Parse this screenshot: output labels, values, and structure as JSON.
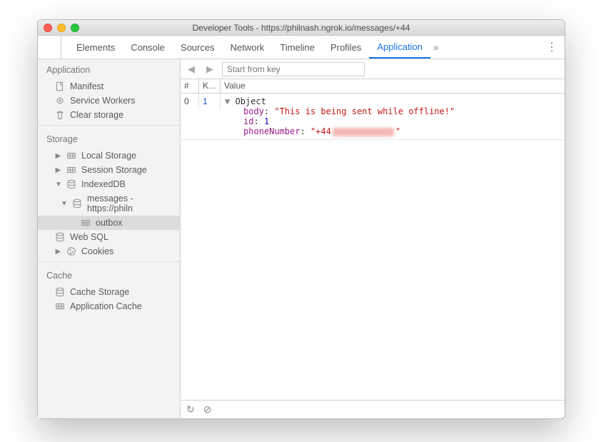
{
  "window": {
    "title": "Developer Tools - https://philnash.ngrok.io/messages/+44"
  },
  "tabs": {
    "items": [
      "Elements",
      "Console",
      "Sources",
      "Network",
      "Timeline",
      "Profiles",
      "Application"
    ],
    "active": "Application"
  },
  "sidebar": {
    "sections": [
      {
        "title": "Application",
        "items": [
          {
            "label": "Manifest",
            "icon": "doc"
          },
          {
            "label": "Service Workers",
            "icon": "gear"
          },
          {
            "label": "Clear storage",
            "icon": "trash"
          }
        ]
      },
      {
        "title": "Storage",
        "items": [
          {
            "label": "Local Storage",
            "icon": "grid",
            "expandable": true,
            "expanded": false
          },
          {
            "label": "Session Storage",
            "icon": "grid",
            "expandable": true,
            "expanded": false
          },
          {
            "label": "IndexedDB",
            "icon": "db",
            "expandable": true,
            "expanded": true,
            "children": [
              {
                "label": "messages - https://philn",
                "icon": "db",
                "expandable": true,
                "expanded": true,
                "children": [
                  {
                    "label": "outbox",
                    "icon": "grid",
                    "selected": true
                  }
                ]
              }
            ]
          },
          {
            "label": "Web SQL",
            "icon": "db"
          },
          {
            "label": "Cookies",
            "icon": "cookie",
            "expandable": true,
            "expanded": false
          }
        ]
      },
      {
        "title": "Cache",
        "items": [
          {
            "label": "Cache Storage",
            "icon": "db"
          },
          {
            "label": "Application Cache",
            "icon": "grid"
          }
        ]
      }
    ]
  },
  "toolbar": {
    "placeholder": "Start from key"
  },
  "table": {
    "headers": {
      "n": "#",
      "k": "K…",
      "v": "Value"
    },
    "rows": [
      {
        "n": "0",
        "k": "1",
        "value": {
          "type": "Object",
          "props": [
            {
              "name": "body",
              "kind": "str",
              "val": "\"This is being sent while offline!\""
            },
            {
              "name": "id",
              "kind": "num",
              "val": "1"
            },
            {
              "name": "phoneNumber",
              "kind": "str",
              "val": "\"+44",
              "redacted": true,
              "valEnd": "\""
            }
          ]
        }
      }
    ]
  }
}
